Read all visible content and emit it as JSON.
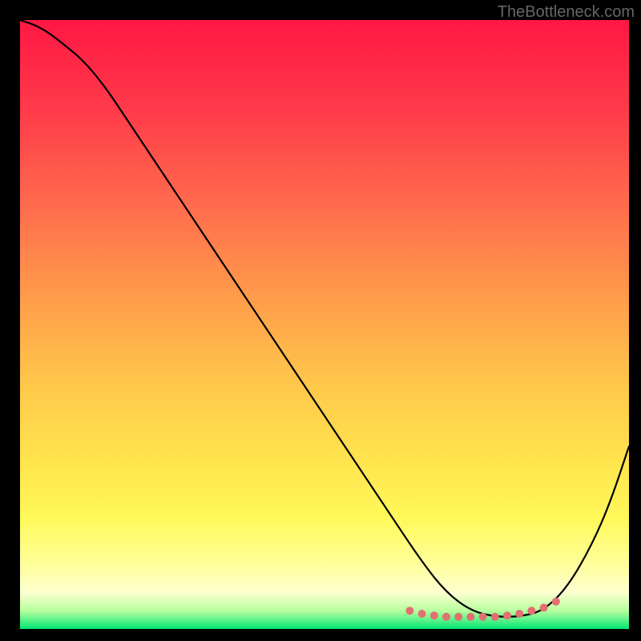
{
  "watermark": "TheBottleneck.com",
  "chart_data": {
    "type": "line",
    "title": "",
    "xlabel": "",
    "ylabel": "",
    "xlim": [
      0,
      100
    ],
    "ylim": [
      0,
      100
    ],
    "series": [
      {
        "name": "curve",
        "x": [
          0,
          3,
          6,
          12,
          20,
          30,
          40,
          50,
          60,
          66,
          70,
          74,
          78,
          82,
          86,
          90,
          94,
          97,
          100
        ],
        "values": [
          100,
          99,
          97,
          92,
          80,
          65,
          50,
          35,
          20,
          11,
          6,
          3,
          2,
          2,
          3,
          7,
          14,
          21,
          30
        ]
      }
    ],
    "markers": {
      "name": "highlight-dots",
      "x": [
        64,
        66,
        68,
        70,
        72,
        74,
        76,
        78,
        80,
        82,
        84,
        86,
        88
      ],
      "values": [
        3,
        2.5,
        2.2,
        2,
        2,
        2,
        2,
        2,
        2.2,
        2.5,
        3,
        3.5,
        4.5
      ],
      "color": "#e27070"
    },
    "gradient_stops": [
      {
        "pos": 0.0,
        "color": "#ff1744"
      },
      {
        "pos": 0.15,
        "color": "#ff3b4a"
      },
      {
        "pos": 0.3,
        "color": "#ff6a4d"
      },
      {
        "pos": 0.45,
        "color": "#ff9a4a"
      },
      {
        "pos": 0.6,
        "color": "#ffc84a"
      },
      {
        "pos": 0.72,
        "color": "#ffe34d"
      },
      {
        "pos": 0.82,
        "color": "#fff95a"
      },
      {
        "pos": 0.9,
        "color": "#ffffa0"
      },
      {
        "pos": 0.94,
        "color": "#fdffd0"
      },
      {
        "pos": 0.97,
        "color": "#b8ff9e"
      },
      {
        "pos": 1.0,
        "color": "#00e676"
      }
    ]
  }
}
